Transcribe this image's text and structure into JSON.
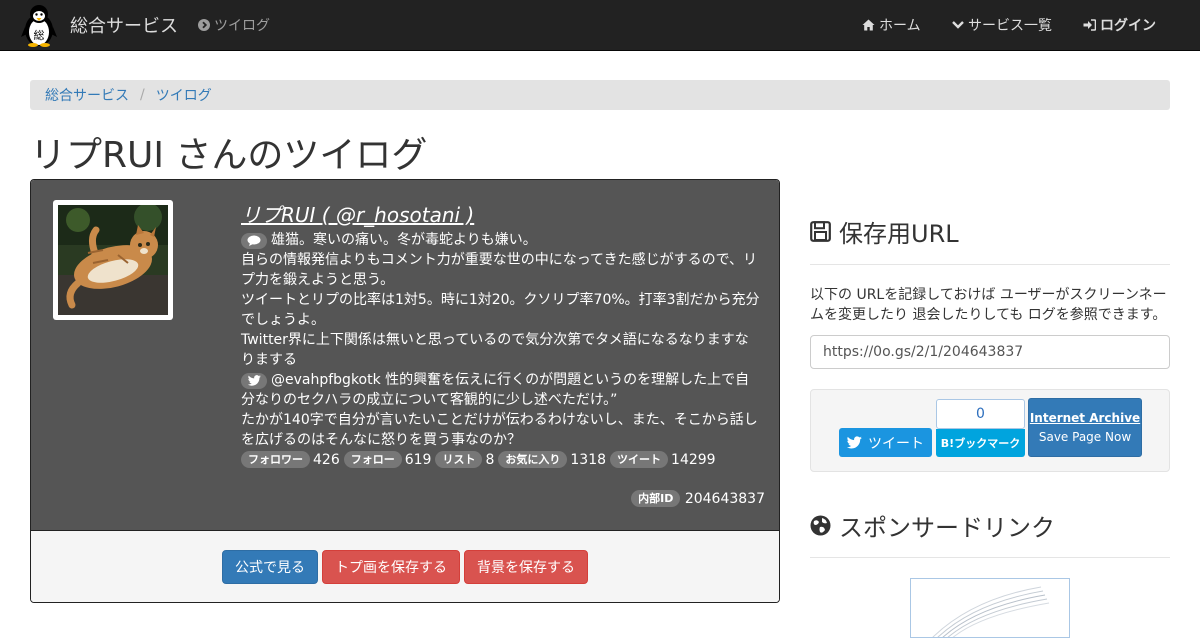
{
  "navbar": {
    "brand": "総合サービス",
    "current": "ツイログ",
    "home": "ホーム",
    "services": "サービス一覧",
    "login": "ログイン"
  },
  "breadcrumb": [
    "総合サービス",
    "ツイログ"
  ],
  "page_title": "リプRUI さんのツイログ",
  "profile": {
    "name": "リプRUI ( @r_hosotani )",
    "bio_lines": [
      "雄猫。寒いの痛い。冬が毒蛇よりも嫌い。",
      "自らの情報発信よりもコメント力が重要な世の中になってきた感じがするので、リプ力を鍛えようと思う。",
      "ツイートとリプの比率は1対5。時に1対20。クソリプ率70%。打率3割だから充分でしょうよ。",
      "Twitter界に上下関係は無いと思っているので気分次第でタメ語になるなりますなりまする"
    ],
    "tweet_lines": [
      "@evahpfbgkotk 性的興奮を伝えに行くのが問題というのを理解した上で自分なりのセクハラの成立について客観的に少し述べただけ。”",
      "たかが140字で自分が言いたいことだけが伝わるわけないし、また、そこから話しを広げるのはそんなに怒りを買う事なのか？"
    ],
    "stats": [
      {
        "label": "フォロワー",
        "value": "426"
      },
      {
        "label": "フォロー",
        "value": "619"
      },
      {
        "label": "リスト",
        "value": "8"
      },
      {
        "label": "お気に入り",
        "value": "1318"
      },
      {
        "label": "ツイート",
        "value": "14299"
      }
    ],
    "internal_label": "内部ID",
    "internal_id": "204643837",
    "buttons": {
      "official": "公式で見る",
      "save_icon": "トプ画を保存する",
      "save_bg": "背景を保存する"
    }
  },
  "sidebar": {
    "save_heading": "保存用URL",
    "save_desc": "以下の URLを記録しておけば ユーザーがスクリーンネームを変更したり 退会したりしても ログを参照できます。",
    "url": "https://0o.gs/2/1/204643837",
    "tweet_label": "ツイート",
    "hatena_count": "0",
    "hatena_label": "B!ブックマーク",
    "archive_title": "Internet Archive",
    "archive_sub": "Save Page Now",
    "sponsor_heading": "スポンサードリンク"
  },
  "colors": {
    "navbar_bg": "#222222",
    "primary": "#337ab7",
    "danger": "#d9534f",
    "panel_dark": "#555555",
    "twitter": "#1b95e0",
    "hatena": "#00a4de"
  }
}
